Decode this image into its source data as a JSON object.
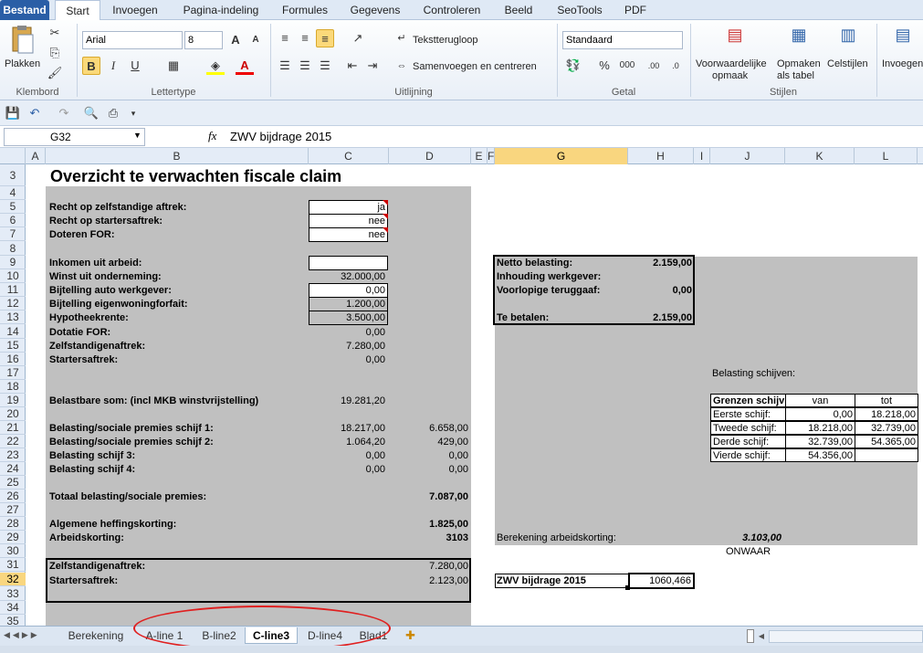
{
  "ribbon_tabs": [
    "Bestand",
    "Start",
    "Invoegen",
    "Pagina-indeling",
    "Formules",
    "Gegevens",
    "Controleren",
    "Beeld",
    "SeoTools",
    "PDF"
  ],
  "active_tab": "Start",
  "clipboard": {
    "paste": "Plakken",
    "group": "Klembord"
  },
  "font": {
    "name": "Arial",
    "size": "8",
    "group": "Lettertype"
  },
  "alignment": {
    "wrap": "Tekstterugloop",
    "merge": "Samenvoegen en centreren",
    "group": "Uitlijning"
  },
  "number": {
    "format": "Standaard",
    "group": "Getal",
    "percent": "%",
    "thousands": "000"
  },
  "styles": {
    "conditional": "Voorwaardelijke",
    "conditional2": "opmaak",
    "table": "Opmaken",
    "table2": "als tabel",
    "cell": "Celstijlen",
    "group": "Stijlen"
  },
  "insert": "Invoegen",
  "name_box": "G32",
  "formula_label": "fx",
  "formula_value": "ZWV bijdrage 2015",
  "columns": [
    "A",
    "B",
    "C",
    "D",
    "E",
    "F",
    "G",
    "H",
    "I",
    "J",
    "K",
    "L"
  ],
  "rows": [
    "3",
    "4",
    "5",
    "6",
    "7",
    "8",
    "9",
    "10",
    "11",
    "12",
    "13",
    "14",
    "15",
    "16",
    "17",
    "18",
    "19",
    "20",
    "21",
    "22",
    "23",
    "24",
    "25",
    "26",
    "27",
    "28",
    "29",
    "30",
    "31",
    "32",
    "33",
    "34",
    "35"
  ],
  "sheet": {
    "title": "Overzicht te verwachten fiscale claim",
    "r5": {
      "label": "Recht op zelfstandige aftrek:",
      "value": "ja"
    },
    "r6": {
      "label": "Recht op startersaftrek:",
      "value": "nee"
    },
    "r7": {
      "label": "Doteren FOR:",
      "value": "nee"
    },
    "r9": {
      "label": "Inkomen uit arbeid:",
      "value": ""
    },
    "r10": {
      "label": "Winst uit onderneming:",
      "value": "32.000,00"
    },
    "r11": {
      "label": "Bijtelling auto werkgever:",
      "value": "0,00"
    },
    "r12": {
      "label": "Bijtelling eigenwoningforfait:",
      "value": "1.200,00"
    },
    "r13": {
      "label": "Hypotheekrente:",
      "value": "3.500,00"
    },
    "r14": {
      "label": "Dotatie FOR:",
      "value": "0,00"
    },
    "r15": {
      "label": "Zelfstandigenaftrek:",
      "value": "7.280,00"
    },
    "r16": {
      "label": "Startersaftrek:",
      "value": "0,00"
    },
    "r19": {
      "label": "Belastbare som: (incl MKB winstvrijstelling)",
      "value": "19.281,20"
    },
    "r21": {
      "label": "Belasting/sociale premies schijf 1:",
      "c": "18.217,00",
      "d": "6.658,00"
    },
    "r22": {
      "label": "Belasting/sociale premies schijf 2:",
      "c": "1.064,20",
      "d": "429,00"
    },
    "r23": {
      "label": "Belasting schijf 3:",
      "c": "0,00",
      "d": "0,00"
    },
    "r24": {
      "label": "Belasting schijf 4:",
      "c": "0,00",
      "d": "0,00"
    },
    "r26": {
      "label": "Totaal belasting/sociale premies:",
      "d": "7.087,00"
    },
    "r28": {
      "label": "Algemene heffingskorting:",
      "d": "1.825,00"
    },
    "r29": {
      "label": "Arbeidskorting:",
      "d": "3103"
    },
    "r31": {
      "label": "Zelfstandigenaftrek:",
      "d": "7.280,00"
    },
    "r32": {
      "label": "Startersaftrek:",
      "d": "2.123,00"
    },
    "netto": {
      "label": "Netto belasting:",
      "value": "2.159,00"
    },
    "inhouding": {
      "label": "Inhouding werkgever:",
      "value": ""
    },
    "voorlopige": {
      "label": "Voorlopige teruggaaf:",
      "value": "0,00"
    },
    "tebetalen": {
      "label": "Te betalen:",
      "value": "2.159,00"
    },
    "schijven_title": "Belasting schijven:",
    "schijven_header": [
      "Grenzen schijv",
      "van",
      "tot"
    ],
    "schijven": [
      [
        "Eerste schijf:",
        "0,00",
        "18.218,00"
      ],
      [
        "Tweede schijf:",
        "18.218,00",
        "32.739,00"
      ],
      [
        "Derde schijf:",
        "32.739,00",
        "54.365,00"
      ],
      [
        "Vierde schijf:",
        "54.356,00",
        ""
      ]
    ],
    "arbeidskorting": {
      "label": "Berekening arbeidskorting:",
      "value": "3.103,00"
    },
    "onwaar": "ONWAAR",
    "zwv": {
      "label": "ZWV bijdrage 2015",
      "value": "1060,466"
    }
  },
  "sheet_tabs": [
    "Berekening",
    "A-line 1",
    "B-line2",
    "C-line3",
    "D-line4",
    "Blad1"
  ],
  "active_sheet": "C-line3"
}
